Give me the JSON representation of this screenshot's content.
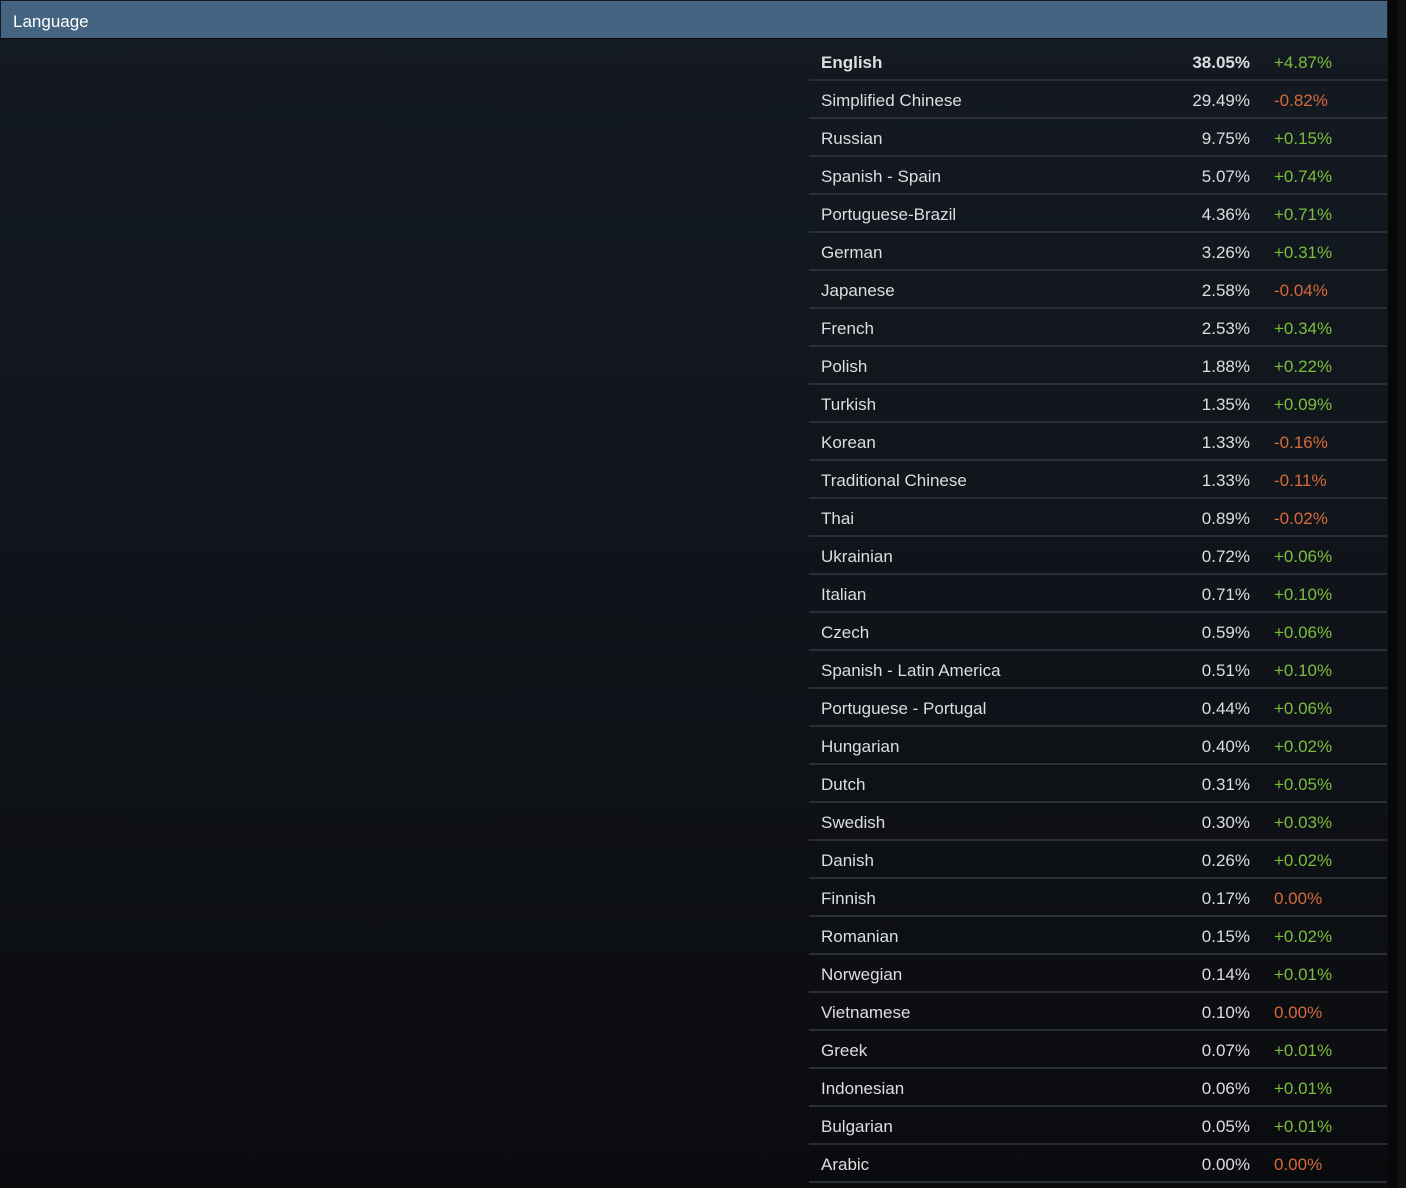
{
  "header": {
    "title": "Language"
  },
  "colors": {
    "positive": "#7cbe3c",
    "negative": "#d66a3a",
    "header_bg": "#456482"
  },
  "languages": [
    {
      "name": "English",
      "percent": "38.05%",
      "change": "+4.87%",
      "trend": "pos",
      "bold": true
    },
    {
      "name": "Simplified Chinese",
      "percent": "29.49%",
      "change": "-0.82%",
      "trend": "neg"
    },
    {
      "name": "Russian",
      "percent": "9.75%",
      "change": "+0.15%",
      "trend": "pos"
    },
    {
      "name": "Spanish - Spain",
      "percent": "5.07%",
      "change": "+0.74%",
      "trend": "pos"
    },
    {
      "name": "Portuguese-Brazil",
      "percent": "4.36%",
      "change": "+0.71%",
      "trend": "pos"
    },
    {
      "name": "German",
      "percent": "3.26%",
      "change": "+0.31%",
      "trend": "pos"
    },
    {
      "name": "Japanese",
      "percent": "2.58%",
      "change": "-0.04%",
      "trend": "neg"
    },
    {
      "name": "French",
      "percent": "2.53%",
      "change": "+0.34%",
      "trend": "pos"
    },
    {
      "name": "Polish",
      "percent": "1.88%",
      "change": "+0.22%",
      "trend": "pos"
    },
    {
      "name": "Turkish",
      "percent": "1.35%",
      "change": "+0.09%",
      "trend": "pos"
    },
    {
      "name": "Korean",
      "percent": "1.33%",
      "change": "-0.16%",
      "trend": "neg"
    },
    {
      "name": "Traditional Chinese",
      "percent": "1.33%",
      "change": "-0.11%",
      "trend": "neg"
    },
    {
      "name": "Thai",
      "percent": "0.89%",
      "change": "-0.02%",
      "trend": "neg"
    },
    {
      "name": "Ukrainian",
      "percent": "0.72%",
      "change": "+0.06%",
      "trend": "pos"
    },
    {
      "name": "Italian",
      "percent": "0.71%",
      "change": "+0.10%",
      "trend": "pos"
    },
    {
      "name": "Czech",
      "percent": "0.59%",
      "change": "+0.06%",
      "trend": "pos"
    },
    {
      "name": "Spanish - Latin America",
      "percent": "0.51%",
      "change": "+0.10%",
      "trend": "pos"
    },
    {
      "name": "Portuguese - Portugal",
      "percent": "0.44%",
      "change": "+0.06%",
      "trend": "pos"
    },
    {
      "name": "Hungarian",
      "percent": "0.40%",
      "change": "+0.02%",
      "trend": "pos"
    },
    {
      "name": "Dutch",
      "percent": "0.31%",
      "change": "+0.05%",
      "trend": "pos"
    },
    {
      "name": "Swedish",
      "percent": "0.30%",
      "change": "+0.03%",
      "trend": "pos"
    },
    {
      "name": "Danish",
      "percent": "0.26%",
      "change": "+0.02%",
      "trend": "pos"
    },
    {
      "name": "Finnish",
      "percent": "0.17%",
      "change": "0.00%",
      "trend": "neg"
    },
    {
      "name": "Romanian",
      "percent": "0.15%",
      "change": "+0.02%",
      "trend": "pos"
    },
    {
      "name": "Norwegian",
      "percent": "0.14%",
      "change": "+0.01%",
      "trend": "pos"
    },
    {
      "name": "Vietnamese",
      "percent": "0.10%",
      "change": "0.00%",
      "trend": "neg"
    },
    {
      "name": "Greek",
      "percent": "0.07%",
      "change": "+0.01%",
      "trend": "pos"
    },
    {
      "name": "Indonesian",
      "percent": "0.06%",
      "change": "+0.01%",
      "trend": "pos"
    },
    {
      "name": "Bulgarian",
      "percent": "0.05%",
      "change": "+0.01%",
      "trend": "pos"
    },
    {
      "name": "Arabic",
      "percent": "0.00%",
      "change": "0.00%",
      "trend": "neg"
    }
  ]
}
